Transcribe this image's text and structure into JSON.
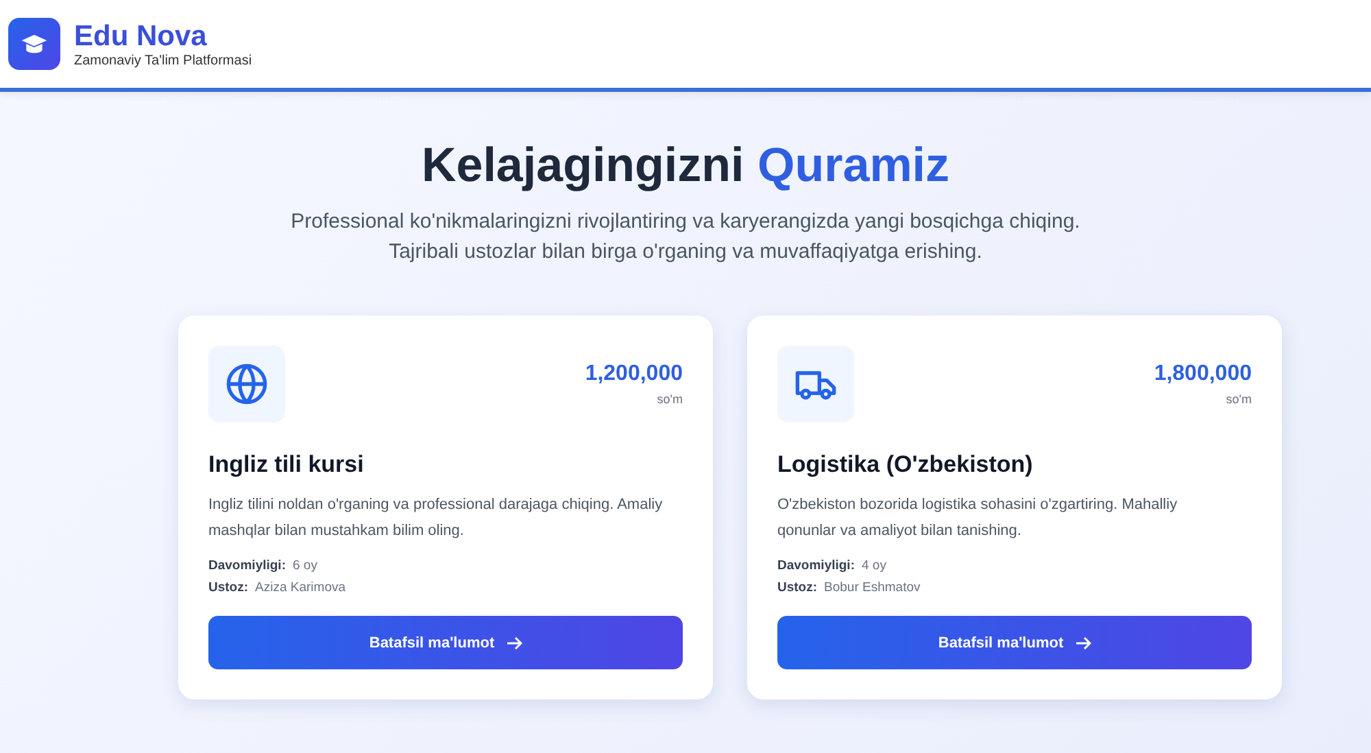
{
  "header": {
    "brand": "Edu Nova",
    "tagline": "Zamonaviy Ta'lim Platformasi"
  },
  "hero": {
    "title": "Kelajagingizni",
    "title_accent": "Quramiz",
    "subtitle_lines": [
      "Professional ko'nikmalaringizni rivojlantiring va karyerangizda yangi bosqichga chiqing.",
      "Tajribali ustozlar bilan birga o'rganing va muvaffaqiyatga erishing."
    ]
  },
  "courses": [
    {
      "kind": "globe",
      "price": "1,200,000",
      "currency": "so'm",
      "title": "Ingliz tili kursi",
      "description": "Ingliz tilini noldan o'rganing va professional darajaga chiqing. Amaliy mashqlar bilan mustahkam bilim oling.",
      "meta": [
        {
          "label": "Davomiyligi:",
          "value": "6 oy"
        },
        {
          "label": "Ustoz:",
          "value": "Aziza Karimova"
        }
      ],
      "button": "Batafsil ma'lumot"
    },
    {
      "kind": "truck",
      "price": "1,800,000",
      "currency": "so'm",
      "title": "Logistika (O'zbekiston)",
      "description": "O'zbekiston bozorida logistika sohasini o'zgartiring. Mahalliy qonunlar va amaliyot bilan tanishing.",
      "meta": [
        {
          "label": "Davomiyligi:",
          "value": "4 oy"
        },
        {
          "label": "Ustoz:",
          "value": "Bobur Eshmatov"
        }
      ],
      "button": "Batafsil ma'lumot"
    }
  ]
}
